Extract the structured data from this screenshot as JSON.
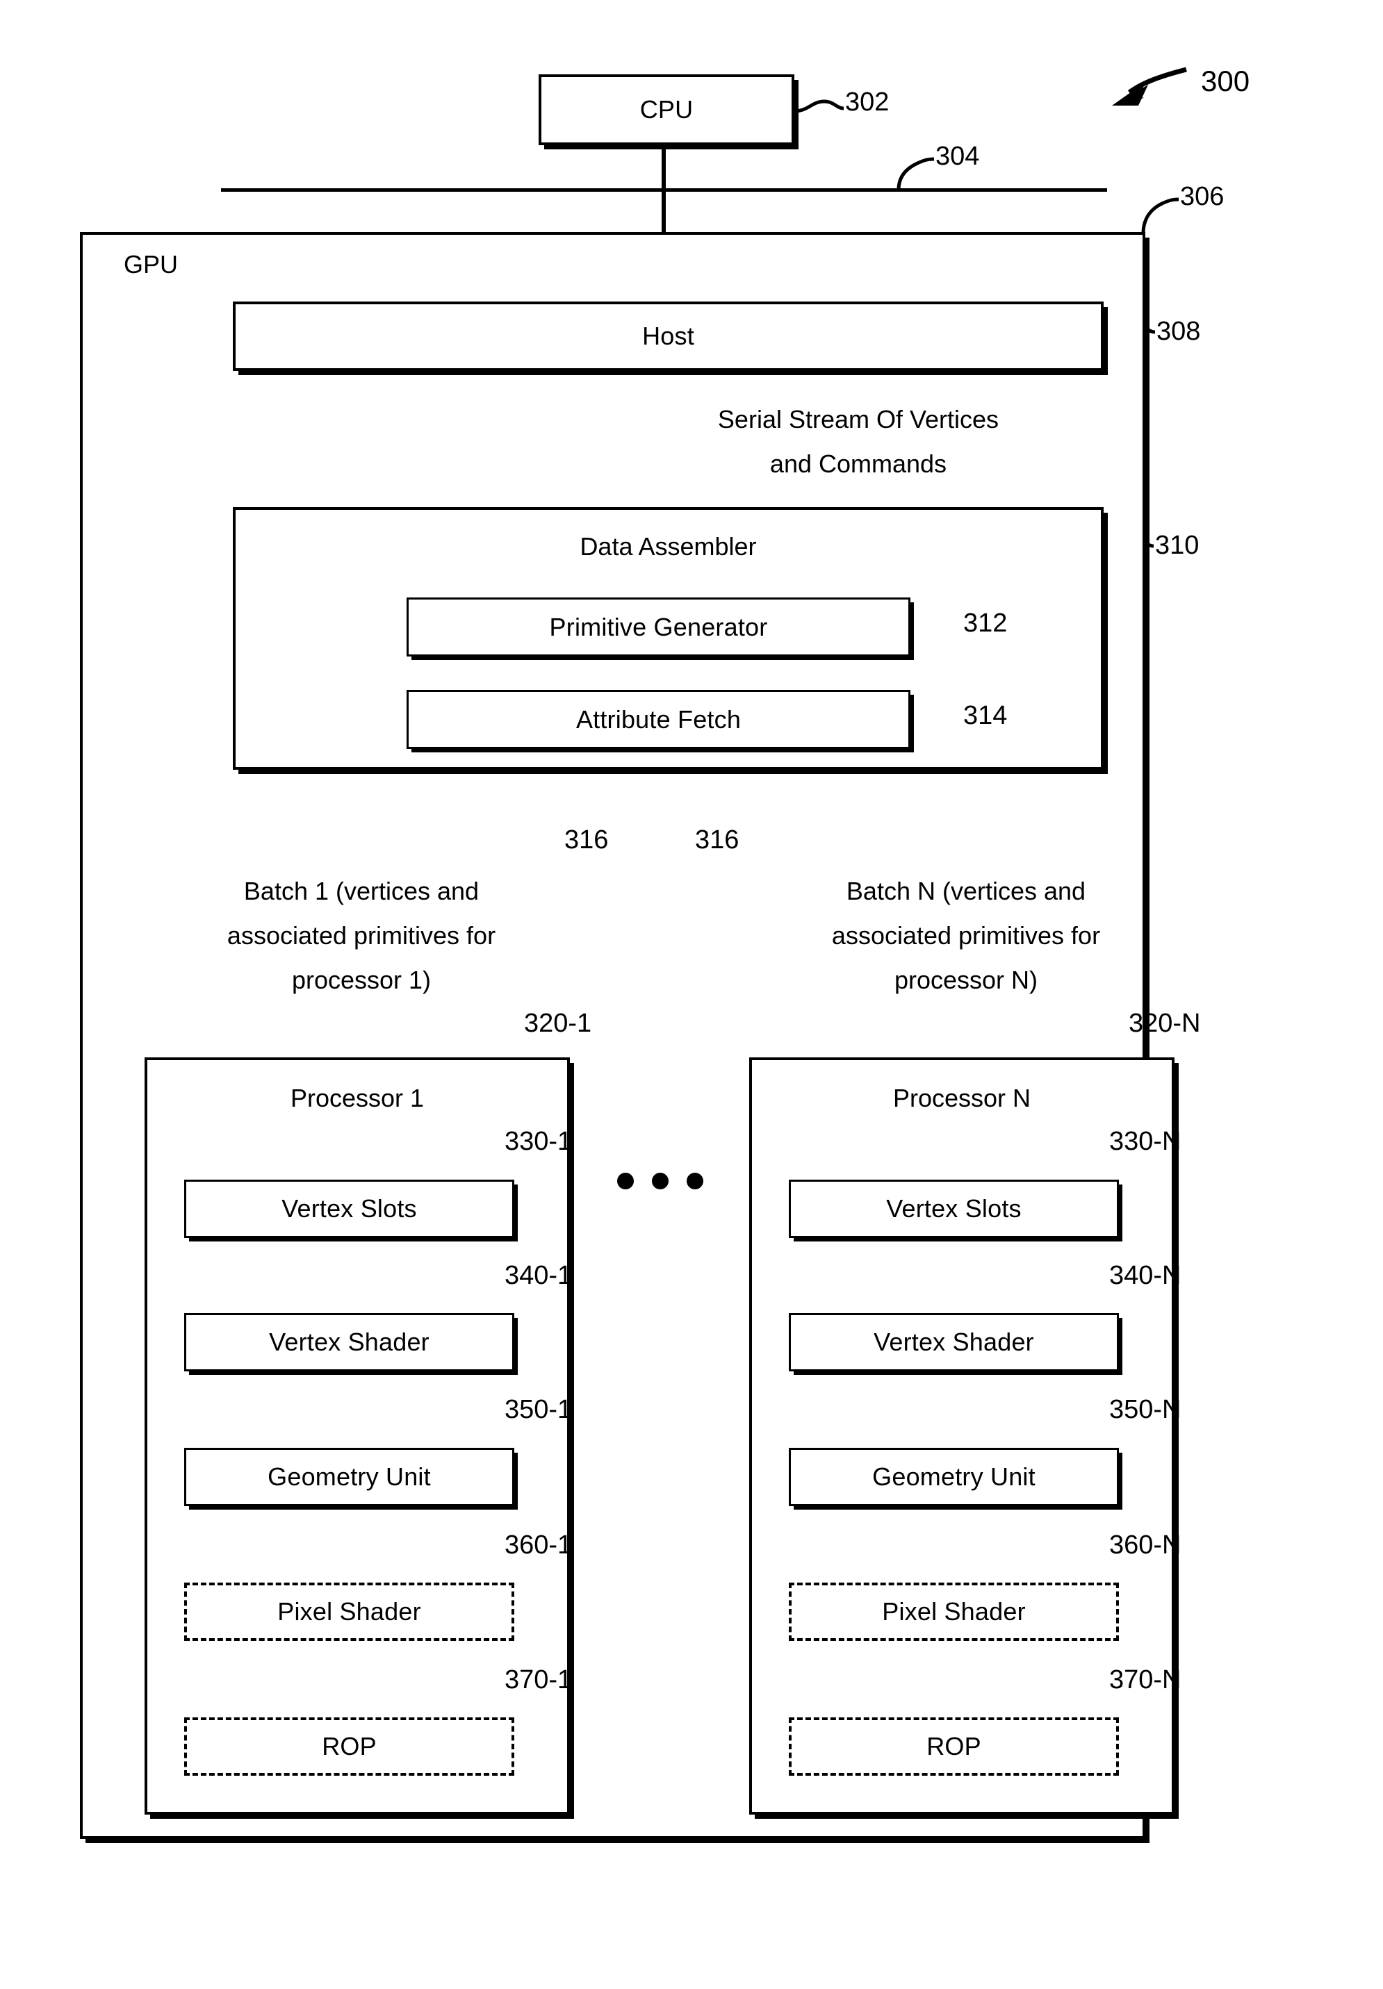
{
  "figure": {
    "figure_number": "300",
    "title_block": {
      "cpu": "CPU",
      "gpu": "GPU",
      "host": "Host",
      "data_assembler": "Data Assembler",
      "primitive_generator": "Primitive Generator",
      "attribute_fetch": "Attribute Fetch"
    },
    "stream_label_line1": "Serial Stream Of Vertices",
    "stream_label_line2": "and Commands",
    "batch_left": {
      "line1": "Batch 1 (vertices and",
      "line2": "associated primitives for",
      "line3": "processor 1)"
    },
    "batch_right": {
      "line1": "Batch N (vertices and",
      "line2": "associated primitives for",
      "line3": "processor N)"
    },
    "ellipsis": "• • •",
    "reference_numerals": {
      "figure": "300",
      "cpu": "302",
      "bus": "304",
      "gpu": "306",
      "host": "308",
      "data_assembler": "310",
      "primitive_generator": "312",
      "attribute_fetch": "314",
      "batch_left": "316",
      "batch_right": "316",
      "processor_1": "320-1",
      "processor_n": "320-N",
      "vertex_slots_1": "330-1",
      "vertex_slots_n": "330-N",
      "vertex_shader_1": "340-1",
      "vertex_shader_n": "340-N",
      "geometry_unit_1": "350-1",
      "geometry_unit_n": "350-N",
      "pixel_shader_1": "360-1",
      "pixel_shader_n": "360-N",
      "rop_1": "370-1",
      "rop_n": "370-N"
    },
    "processors": [
      {
        "title": "Processor 1",
        "ref": "320-1",
        "units": [
          {
            "label": "Vertex Slots",
            "ref": "330-1",
            "style": "solid"
          },
          {
            "label": "Vertex Shader",
            "ref": "340-1",
            "style": "solid"
          },
          {
            "label": "Geometry Unit",
            "ref": "350-1",
            "style": "solid"
          },
          {
            "label": "Pixel Shader",
            "ref": "360-1",
            "style": "dashed"
          },
          {
            "label": "ROP",
            "ref": "370-1",
            "style": "dashed"
          }
        ]
      },
      {
        "title": "Processor N",
        "ref": "320-N",
        "units": [
          {
            "label": "Vertex Slots",
            "ref": "330-N",
            "style": "solid"
          },
          {
            "label": "Vertex Shader",
            "ref": "340-N",
            "style": "solid"
          },
          {
            "label": "Geometry Unit",
            "ref": "350-N",
            "style": "solid"
          },
          {
            "label": "Pixel Shader",
            "ref": "360-N",
            "style": "dashed"
          },
          {
            "label": "ROP",
            "ref": "370-N",
            "style": "dashed"
          }
        ]
      }
    ]
  },
  "colors": {
    "ink": "#000000",
    "paper": "#ffffff"
  }
}
